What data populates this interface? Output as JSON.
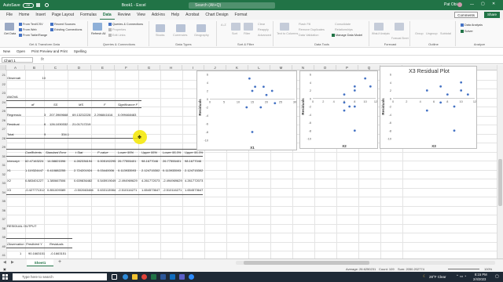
{
  "titlebar": {
    "autosave_label": "AutoSave",
    "autosave_state": "Off",
    "filename": "Book1 - Excel",
    "search_placeholder": "Search (Alt+Q)",
    "user": "Pat Obi"
  },
  "menu": {
    "items": [
      "File",
      "Home",
      "Insert",
      "Page Layout",
      "Formulas",
      "Data",
      "Review",
      "View",
      "Add-ins",
      "Help",
      "Acrobat",
      "Chart Design",
      "Format"
    ],
    "active": "Data",
    "comments": "Comments",
    "share": "Share"
  },
  "ribbon": {
    "get_data": "Get Data",
    "from_text": "From Text/CSV",
    "from_web": "From Web",
    "from_table": "From Table/Range",
    "recent_sources": "Recent Sources",
    "existing_connections": "Existing Connections",
    "group_get_transform": "Get & Transform Data",
    "refresh_all": "Refresh All",
    "queries_connections": "Queries & Connections",
    "properties": "Properties",
    "edit_links": "Edit Links",
    "group_queries": "Queries & Connections",
    "stocks": "Stocks",
    "currencies": "Currencies",
    "geography": "Geography",
    "group_data_types": "Data Types",
    "sort": "Sort",
    "filter": "Filter",
    "clear": "Clear",
    "reapply": "Reapply",
    "advanced": "Advanced",
    "group_sort_filter": "Sort & Filter",
    "text_to_columns": "Text to Columns",
    "flash_fill": "Flash Fill",
    "remove_duplicates": "Remove Duplicates",
    "data_validation": "Data Validation",
    "consolidate": "Consolidate",
    "relationships": "Relationships",
    "manage_data_model": "Manage Data Model",
    "group_data_tools": "Data Tools",
    "what_if": "What-If Analysis",
    "forecast_sheet": "Forecast Sheet",
    "group_forecast": "Forecast",
    "group": "Group",
    "ungroup": "Ungroup",
    "subtotal": "Subtotal",
    "group_outline": "Outline",
    "data_analysis": "Data Analysis",
    "solver": "Solver",
    "group_analyze": "Analyze"
  },
  "toolbar2": [
    "New",
    "Open",
    "Print Preview and Print",
    "Spelling"
  ],
  "formula": {
    "namebox": "Chart 1",
    "fx": "fx"
  },
  "columns": [
    "A",
    "B",
    "C",
    "D",
    "E",
    "F",
    "G",
    "H",
    "I",
    "J",
    "K",
    "L",
    "M",
    "N",
    "O",
    "P",
    "Q",
    "R",
    "S"
  ],
  "rows": [
    "21",
    "22",
    "23",
    "24",
    "25",
    "26",
    "27",
    "28",
    "29",
    "30",
    "31",
    "32",
    "33",
    "34",
    "35",
    "36",
    "37",
    "38",
    "39",
    "40",
    "41"
  ],
  "sheet": {
    "observations_label": "Observati",
    "observations_value": "10",
    "anova_label": "ANOVA",
    "anova_headers": [
      "df",
      "SS",
      "MS",
      "F",
      "Significance F"
    ],
    "regression": [
      "Regressio",
      "3",
      "207.3969668",
      "69.13232228",
      "2.296841616",
      "0.099468483"
    ],
    "residual": [
      "Residual",
      "6",
      "126.1030332",
      "21.01717219"
    ],
    "total": [
      "Total",
      "9",
      "334.1"
    ],
    "coef_headers": [
      "Coefficients",
      "Standard Error",
      "t Stat",
      "P-value",
      "Lower 95%",
      "Upper 95%",
      "Lower 95.0%",
      "Upper 95.0%"
    ],
    "intercept": [
      "Intercept",
      "62.47163224",
      "14.58821596",
      "4.282336194",
      "0.005192295",
      "26.77555401",
      "98.1677046",
      "26.77555401",
      "98.1677046"
    ],
    "x1": [
      "X1",
      "1.119324447",
      "0.410882255",
      "2.724201924",
      "0.03440006",
      "0.113933593",
      "2.124715302",
      "0.113933593",
      "2.124715302"
    ],
    "x2": [
      "X2",
      "0.883401227",
      "1.380667506",
      "0.639836482",
      "0.545919049",
      "-2.494969629",
      "4.261772073",
      "-2.494969629",
      "4.261772073"
    ],
    "x3": [
      "X3",
      "-0.427771312",
      "0.851009389",
      "-0.502663466",
      "0.633113984",
      "-2.510116271",
      "1.654573647",
      "-2.510116271",
      "1.654573647"
    ],
    "residual_output": "RESIDUAL OUTPUT",
    "res_headers": [
      "Observation",
      "Predicted Y",
      "Residuals"
    ],
    "res_row1": [
      "1",
      "90.1663151",
      "-0.1663151"
    ]
  },
  "charts": {
    "x1": {
      "xlabel": "X1",
      "ylabel": "Residuals"
    },
    "x2": {
      "xlabel": "X2",
      "ylabel": "Residuals"
    },
    "x3": {
      "title": "X3 Residual Plot",
      "xlabel": "X3",
      "ylabel": "Residuals"
    }
  },
  "chart_data": [
    {
      "type": "scatter",
      "title": "",
      "xlabel": "X1",
      "ylabel": "Residuals",
      "xlim": [
        0,
        30
      ],
      "ylim": [
        -10,
        6
      ],
      "xticks": [
        0,
        5,
        10,
        15,
        20,
        25,
        30
      ],
      "yticks": [
        6,
        4,
        2,
        0,
        -2,
        -4,
        -6,
        -8,
        -10
      ],
      "x": [
        14,
        16,
        15,
        19,
        20,
        22,
        23,
        13,
        18,
        15
      ],
      "y": [
        5,
        3,
        2,
        3,
        1,
        2,
        -1,
        -2,
        -2,
        -8
      ]
    },
    {
      "type": "scatter",
      "title": "",
      "xlabel": "X2",
      "ylabel": "Residuals",
      "xlim": [
        0,
        12
      ],
      "ylim": [
        -10,
        6
      ],
      "xticks": [
        0,
        2,
        4,
        6,
        8,
        10,
        12
      ],
      "yticks": [
        6,
        4,
        2,
        0,
        -2,
        -4,
        -6,
        -8,
        -10
      ],
      "x": [
        6,
        6,
        7,
        8,
        8,
        8,
        10,
        11,
        6,
        8
      ],
      "y": [
        1,
        -1,
        -2,
        3,
        2,
        -2,
        5,
        3,
        -3,
        -8
      ]
    },
    {
      "type": "scatter",
      "title": "X3 Residual Plot",
      "xlabel": "X3",
      "ylabel": "Residuals",
      "xlim": [
        0,
        12
      ],
      "ylim": [
        -10,
        6
      ],
      "xticks": [
        0,
        2,
        4,
        6,
        8,
        10,
        12
      ],
      "yticks": [
        6,
        4,
        2,
        0,
        -2,
        -4,
        -6,
        -8,
        -10
      ],
      "x": [
        5,
        7,
        7,
        8,
        9,
        10,
        10,
        11,
        5,
        9
      ],
      "y": [
        2,
        3,
        -1,
        1,
        -2,
        4,
        2,
        1,
        -3,
        -8
      ]
    }
  ],
  "sheetbar": {
    "tab": "Sheet1",
    "add": "+"
  },
  "status": {
    "average": "Average: 26.6250231",
    "count": "Count: 109",
    "sum": "Sum: 2050.202774",
    "zoom": "100%"
  },
  "taskbar": {
    "search_placeholder": "Type here to search",
    "weather": "28°F  Clear",
    "time": "8:15 PM",
    "date": "2/4/2023"
  },
  "colors": {
    "excel_green": "#217346",
    "marker": "#4472c4",
    "taskbar": "#1f2a36"
  }
}
